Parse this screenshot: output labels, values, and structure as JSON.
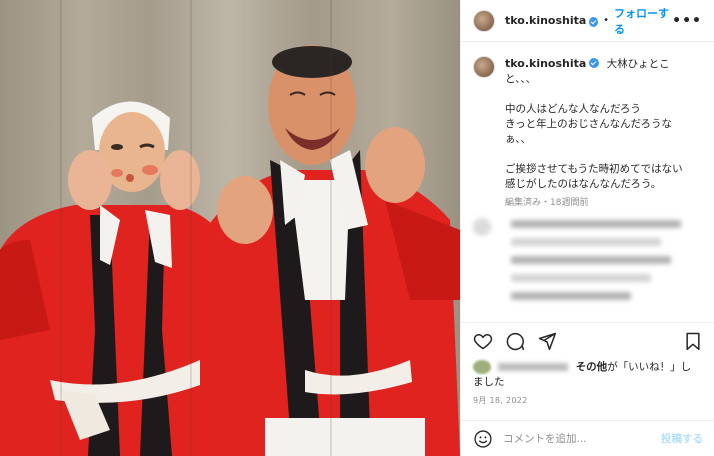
{
  "photo": {
    "description_icon": "photo-two-men-in-red-happi-coats-icon",
    "colors": {
      "happi_red": "#e0231f",
      "wall": "#aea594",
      "skin": "#e1a57f"
    }
  },
  "header": {
    "username": "tko.kinoshita",
    "follow_label": "フォローする",
    "separator": "•",
    "more_label": "•••"
  },
  "caption": {
    "username": "tko.kinoshita",
    "lines": [
      "大林ひょとこ",
      "と、、、",
      "",
      "中の人はどんな人なんだろう",
      "きっと年上のおじさんなんだろうな",
      "ぁ、、",
      "",
      "ご挨拶させてもうた時初めてではない",
      "感じがしたのはなんなんだろう。"
    ],
    "meta": "編集済み・18週間前"
  },
  "likes": {
    "others_label": "その他",
    "text_middle": "が「いいね！」し",
    "text_end": "ました"
  },
  "date": "9月 18, 2022",
  "comment_box": {
    "placeholder": "コメントを追加...",
    "post_label": "投稿する"
  },
  "colors": {
    "accent": "#0095f6",
    "muted": "#8e8e8e",
    "text": "#262626"
  }
}
